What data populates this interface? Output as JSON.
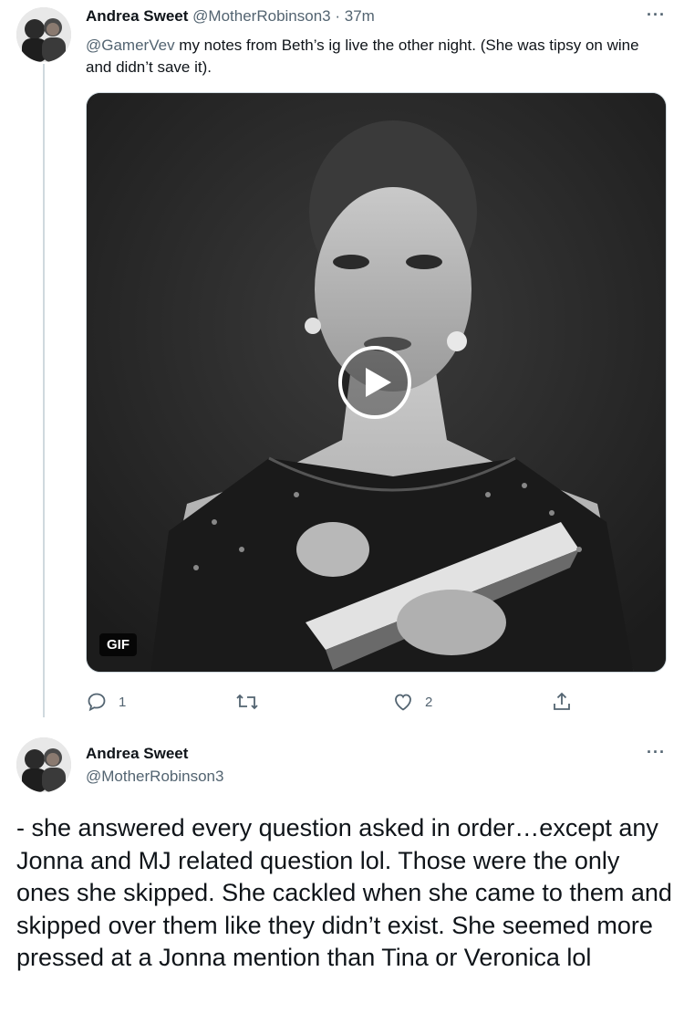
{
  "tweet1": {
    "display_name": "Andrea Sweet",
    "handle": "@MotherRobinson3",
    "separator": "·",
    "time": "37m",
    "more": "···",
    "mention": "@GamerVev",
    "text": " my notes from Beth’s ig live the other night. (She was tipsy on wine and didn’t save it).",
    "media_badge": "GIF",
    "reply_count": "1",
    "retweet_count": "",
    "like_count": "2"
  },
  "tweet2": {
    "display_name": "Andrea Sweet",
    "handle": "@MotherRobinson3",
    "more": "···",
    "text": "- she answered every question asked in order…except any Jonna and MJ related question lol. Those were the only ones she skipped. She cackled when she came to them and skipped over them like they didn’t exist.  She seemed more pressed at a Jonna mention than Tina or Veronica lol"
  },
  "icons": {
    "reply": "reply-icon",
    "retweet": "retweet-icon",
    "like": "heart-icon",
    "share": "share-icon",
    "play": "play-icon",
    "more": "more-icon"
  },
  "colors": {
    "text": "#0f1419",
    "muted": "#536471",
    "thread_line": "#cfd9de"
  }
}
